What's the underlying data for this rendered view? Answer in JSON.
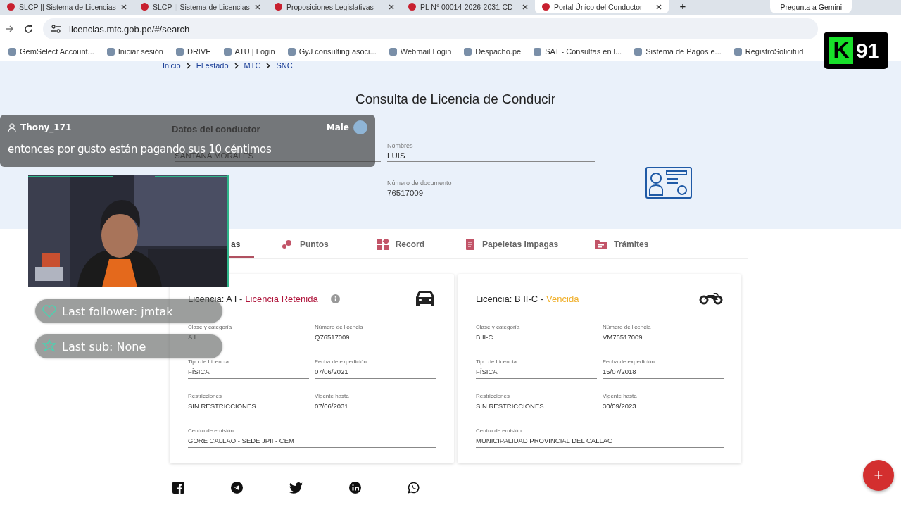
{
  "browser": {
    "tabs": [
      {
        "title": "SLCP || Sistema de Licencias",
        "selected": false
      },
      {
        "title": "SLCP || Sistema de Licencias",
        "selected": false
      },
      {
        "title": "Proposiciones Legislativas",
        "selected": false
      },
      {
        "title": "PL N° 00014-2026-2031-CD",
        "selected": false
      },
      {
        "title": "Portal Único del Conductor",
        "selected": true
      }
    ],
    "new_tab": "+",
    "gemini": "Pregunta a Gemini",
    "url": "licencias.mtc.gob.pe/#/search",
    "bookmarks": [
      "GemSelect Account...",
      "Iniciar sesión",
      "DRIVE",
      "ATU | Login",
      "GyJ consulting asoci...",
      "Webmail Login",
      "Despacho.pe",
      "SAT - Consultas en l...",
      "Sistema de Pagos e...",
      "RegistroSolicitud"
    ]
  },
  "breadcrumb": [
    "Inicio",
    "El estado",
    "MTC",
    "SNC"
  ],
  "title": "Consulta de Licencia de Conducir",
  "driver": {
    "heading": "Datos del conductor",
    "fields": [
      {
        "value": "SANTANA MORALES"
      },
      {
        "label": "Nombres",
        "value": "LUIS"
      },
      {
        "label": "Número de documento",
        "value": "76517009"
      }
    ]
  },
  "tabs": [
    {
      "label": "as",
      "selected": true
    },
    {
      "label": "Puntos",
      "selected": false
    },
    {
      "label": "Record",
      "selected": false
    },
    {
      "label": "Papeletas Impagas",
      "selected": false
    },
    {
      "label": "Trámites",
      "selected": false
    }
  ],
  "licenses": [
    {
      "title": "Licencia: A I -",
      "status": "Licencia Retenida",
      "color": "#b0163c",
      "kind": "car",
      "info": true,
      "fields": [
        {
          "label": "Clase y categoría",
          "value": "A I"
        },
        {
          "label": "Número de licencia",
          "value": "Q76517009"
        },
        {
          "label": "Tipo de Licencia",
          "value": "FÍSICA"
        },
        {
          "label": "Fecha de expedición",
          "value": "07/06/2021"
        },
        {
          "label": "Restricciones",
          "value": "SIN RESTRICCIONES"
        },
        {
          "label": "Vigente hasta",
          "value": "07/06/2031"
        },
        {
          "label": "Centro de emisión",
          "value": "GORE CALLAO - SEDE JPII - CEM"
        }
      ]
    },
    {
      "title": "Licencia: B II-C -",
      "status": "Vencida",
      "color": "#f0b02c",
      "kind": "motorcycle",
      "info": false,
      "fields": [
        {
          "label": "Clase y categoría",
          "value": "B II-C"
        },
        {
          "label": "Número de licencia",
          "value": "VM76517009"
        },
        {
          "label": "Tipo de Licencia",
          "value": "FÍSICA"
        },
        {
          "label": "Fecha de expedición",
          "value": "15/07/2018"
        },
        {
          "label": "Restricciones",
          "value": "SIN RESTRICCIONES"
        },
        {
          "label": "Vigente hasta",
          "value": "30/09/2023"
        },
        {
          "label": "Centro de emisión",
          "value": "MUNICIPALIDAD PROVINCIAL DEL CALLAO"
        }
      ]
    }
  ],
  "fab": "+",
  "overlay": {
    "chat": {
      "user": "Thony_171",
      "gender": "Male",
      "message": "entonces por gusto están pagando sus 10 céntimos"
    },
    "alerts": [
      {
        "kind": "heart",
        "text": "Last follower: jmtak"
      },
      {
        "kind": "star",
        "text": "Last sub: None"
      }
    ],
    "logo": {
      "letter": "K",
      "number": "91"
    }
  }
}
